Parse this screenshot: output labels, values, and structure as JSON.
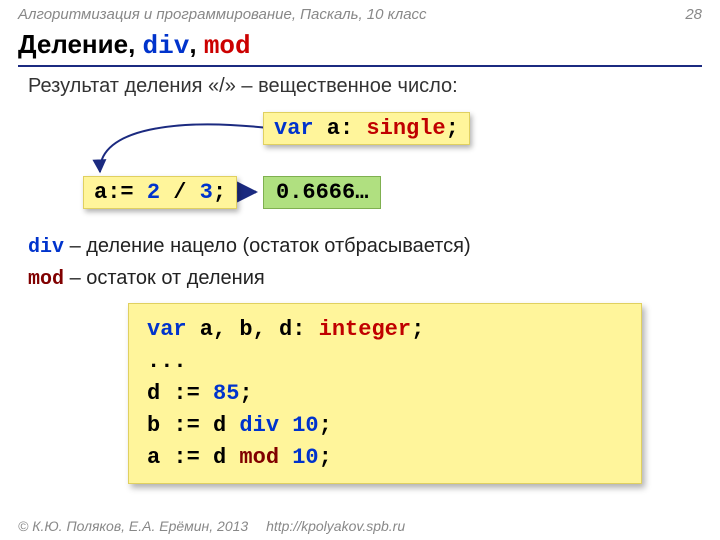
{
  "header": {
    "course": "Алгоритмизация и программирование, Паскаль, 10 класс",
    "page": "28"
  },
  "title": {
    "word": "Деление",
    "sep1": ", ",
    "kw1": "div",
    "sep2": ", ",
    "kw2": "mod"
  },
  "lead": "Результат деления «/» – вещественное число:",
  "box_a": {
    "t1": "a:= ",
    "n1": "2",
    "t2": " / ",
    "n2": "3",
    "t3": ";"
  },
  "box_var": {
    "t1": "var",
    "t2": " a: ",
    "t3": "single",
    "t4": ";"
  },
  "result": "0.6666…",
  "defs": {
    "div_kw": "div",
    "div_txt": " – деление нацело (остаток отбрасывается)",
    "mod_kw": "mod",
    "mod_txt": " – остаток от деления"
  },
  "code": {
    "l1a": "var",
    "l1b": " a, b, d: ",
    "l1c": "integer",
    "l1d": ";",
    "l2": "...",
    "l3a": "d := ",
    "l3b": "85",
    "l3c": ";",
    "l4a": "b := d ",
    "l4b": "div",
    "l4c": " ",
    "l4d": "10",
    "l4e": ";",
    "l5a": "a := d ",
    "l5b": "mod",
    "l5c": " ",
    "l5d": "10",
    "l5e": ";"
  },
  "footer": {
    "copy": "© К.Ю. Поляков, Е.А. Ерёмин, 2013",
    "site": "http://kpolyakov.spb.ru"
  }
}
